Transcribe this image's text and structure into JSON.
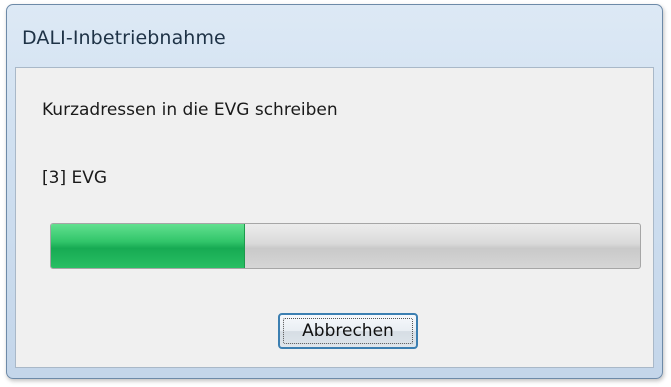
{
  "window": {
    "title": "DALI-Inbetriebnahme"
  },
  "dialog": {
    "message": "Kurzadressen in die EVG schreiben",
    "device_status": "[3] EVG",
    "progress_fraction": 0.33,
    "cancel_label": "Abbrechen"
  },
  "colors": {
    "progress_fill": "#2fc468",
    "button_border": "#3c7fb1"
  }
}
